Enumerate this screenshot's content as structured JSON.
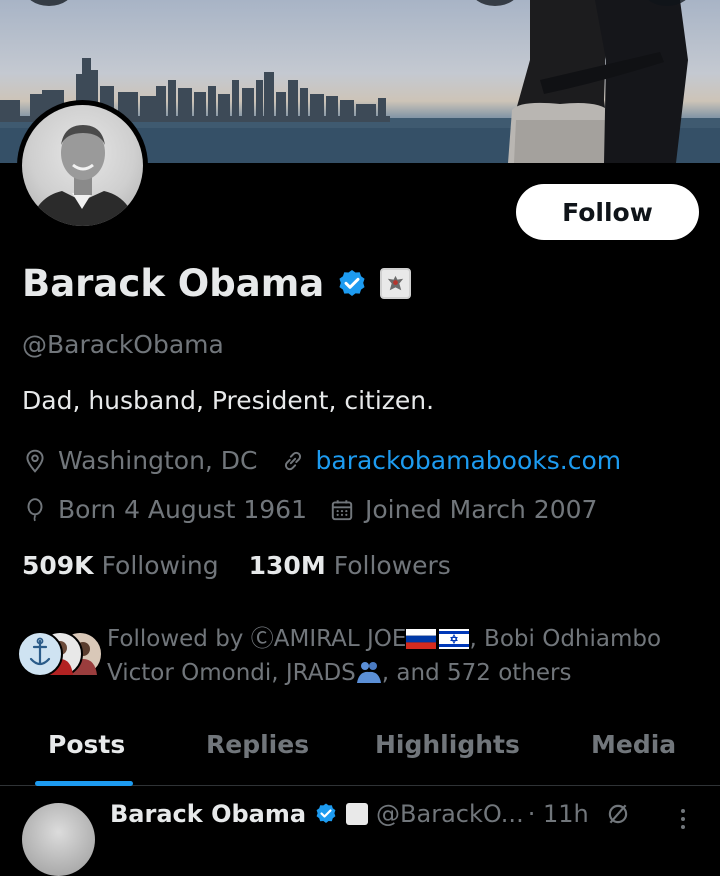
{
  "profile": {
    "display_name": "Barack Obama",
    "handle": "@BarackObama",
    "bio": "Dad, husband, President, citizen.",
    "location": "Washington, DC",
    "website": "barackobamabooks.com",
    "birthday": "Born 4 August 1961",
    "joined": "Joined March 2007",
    "following_count": "509K",
    "following_label": "Following",
    "followers_count": "130M",
    "followers_label": "Followers",
    "verified": true,
    "verified_color": "#1d9bf0"
  },
  "actions": {
    "follow_label": "Follow"
  },
  "followed_by": {
    "prefix": "Followed by ",
    "name1": "ⒸAMIRAL JOE",
    "sep1": ", Bobi Odhiambo",
    "line2": "Victor Omondi, JRADS",
    "suffix": ", and 572 others"
  },
  "tabs": [
    {
      "label": "Posts",
      "active": true
    },
    {
      "label": "Replies"
    },
    {
      "label": "Highlights"
    },
    {
      "label": "Media"
    }
  ],
  "post": {
    "author": "Barack Obama",
    "handle": "@BarackO...",
    "time": "· 11h"
  },
  "icons": {
    "location": "location-pin-icon",
    "link": "link-icon",
    "birthday": "balloon-icon",
    "joined": "calendar-icon",
    "more": "more-vertical-icon"
  }
}
